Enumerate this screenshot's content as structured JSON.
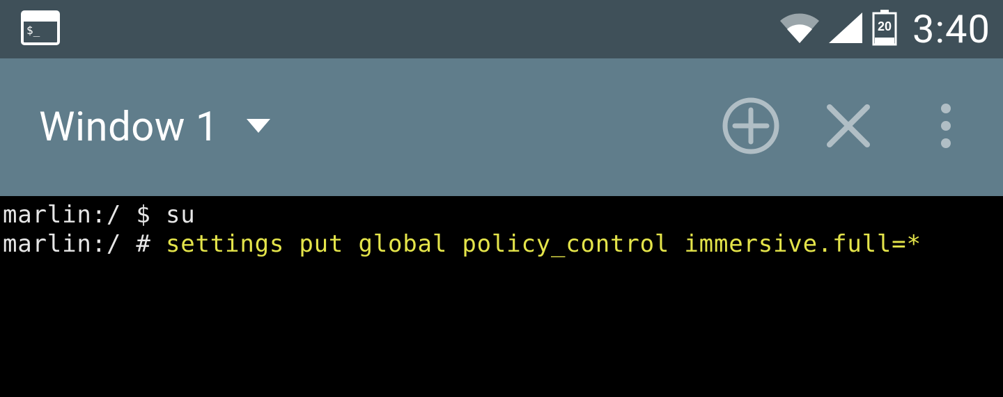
{
  "status_bar": {
    "battery_text": "20",
    "time": "3:40"
  },
  "app_bar": {
    "window_title": "Window 1"
  },
  "terminal": {
    "line1_prompt": "marlin:/ $ ",
    "line1_cmd": "su",
    "line2_prompt": "marlin:/ # ",
    "line2_cmd": "settings put global policy_control immersive.full=*"
  }
}
